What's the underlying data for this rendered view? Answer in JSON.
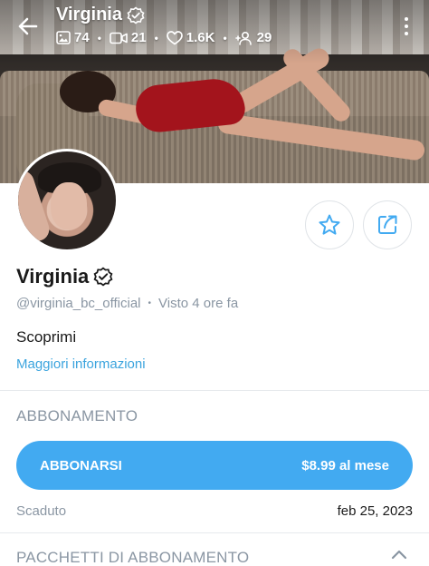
{
  "header": {
    "name": "Virginia",
    "stats": {
      "photos": "74",
      "videos": "21",
      "likes": "1.6K",
      "fans": "29"
    }
  },
  "profile": {
    "name": "Virginia",
    "handle": "@virginia_bc_official",
    "last_seen": "Visto 4 ore fa",
    "bio": "Scoprimi",
    "more_info": "Maggiori informazioni"
  },
  "subscription": {
    "title": "ABBONAMENTO",
    "button_label": "ABBONARSI",
    "button_price": "$8.99 al mese",
    "status_label": "Scaduto",
    "status_date": "feb 25, 2023"
  },
  "bundles": {
    "title": "PACCHETTI DI ABBONAMENTO"
  },
  "colors": {
    "accent": "#42aaf1",
    "link": "#3ba4de",
    "muted": "#8a96a3"
  },
  "icons": [
    "back-arrow-icon",
    "verified-icon",
    "image-icon",
    "video-icon",
    "heart-icon",
    "fans-icon",
    "more-vertical-icon",
    "star-icon",
    "share-icon",
    "chevron-up-icon"
  ]
}
